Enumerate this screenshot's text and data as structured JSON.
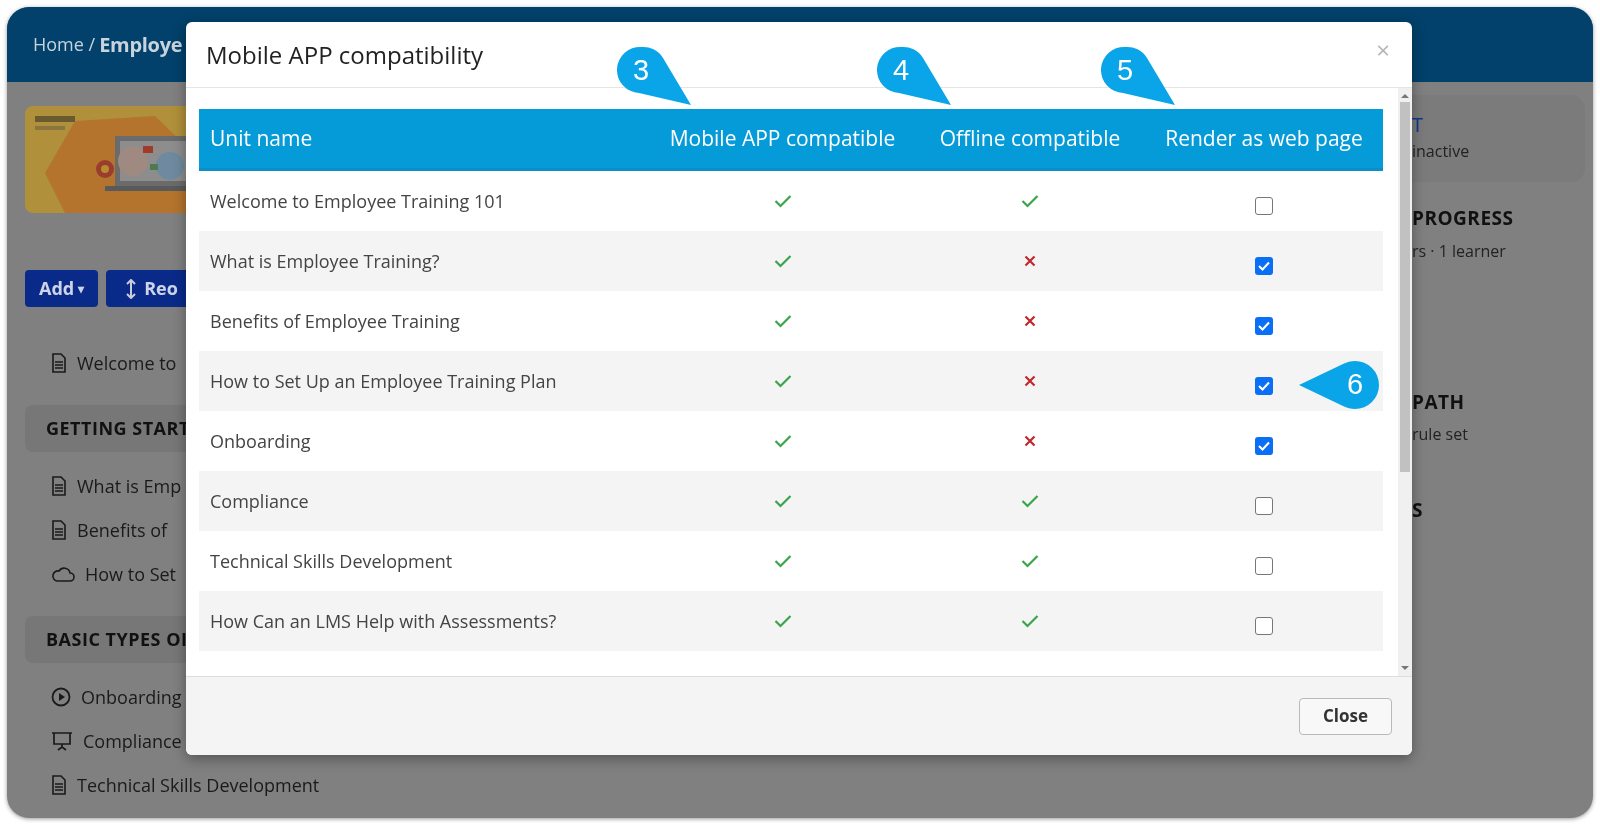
{
  "breadcrumb": {
    "home": "Home /",
    "current": "Employe"
  },
  "toolbar": {
    "add": "Add",
    "add_caret": "▾",
    "reorder": "Reo"
  },
  "left_list": [
    {
      "kind": "document",
      "label": "Welcome to"
    },
    {
      "kind": "section",
      "label": "GETTING START"
    },
    {
      "kind": "document",
      "label": "What is Emp"
    },
    {
      "kind": "document",
      "label": "Benefits of"
    },
    {
      "kind": "cloud",
      "label": "How to Set"
    },
    {
      "kind": "section",
      "label": "BASIC TYPES OI"
    },
    {
      "kind": "play",
      "label": "Onboarding"
    },
    {
      "kind": "presentation",
      "label": "Compliance"
    },
    {
      "kind": "document",
      "label": "Technical Skills Development"
    }
  ],
  "right_panel": {
    "card_title": "T",
    "card_text": "inactive",
    "progress_title": "PROGRESS",
    "progress_text": "rs · 1 learner",
    "path_title": "PATH",
    "path_text": "rule set",
    "last_title": "S"
  },
  "modal": {
    "title": "Mobile APP compatibility",
    "close_icon": "×",
    "columns": [
      "Unit name",
      "Mobile APP compatible",
      "Offline compatible",
      "Render as web page"
    ],
    "rows": [
      {
        "name": "Welcome to Employee Training 101",
        "mobile": true,
        "offline": true,
        "web_page": false
      },
      {
        "name": "What is Employee Training?",
        "mobile": true,
        "offline": false,
        "web_page": true
      },
      {
        "name": "Benefits of Employee Training",
        "mobile": true,
        "offline": false,
        "web_page": true
      },
      {
        "name": "How to Set Up an Employee Training Plan",
        "mobile": true,
        "offline": false,
        "web_page": true
      },
      {
        "name": "Onboarding",
        "mobile": true,
        "offline": false,
        "web_page": true
      },
      {
        "name": "Compliance",
        "mobile": true,
        "offline": true,
        "web_page": false
      },
      {
        "name": "Technical Skills Development",
        "mobile": true,
        "offline": true,
        "web_page": false
      },
      {
        "name": "How Can an LMS Help with Assessments?",
        "mobile": true,
        "offline": true,
        "web_page": false
      }
    ],
    "close_button": "Close"
  },
  "callouts": [
    {
      "label": "3",
      "kind": "down"
    },
    {
      "label": "4",
      "kind": "down"
    },
    {
      "label": "5",
      "kind": "down"
    },
    {
      "label": "6",
      "kind": "left"
    }
  ]
}
